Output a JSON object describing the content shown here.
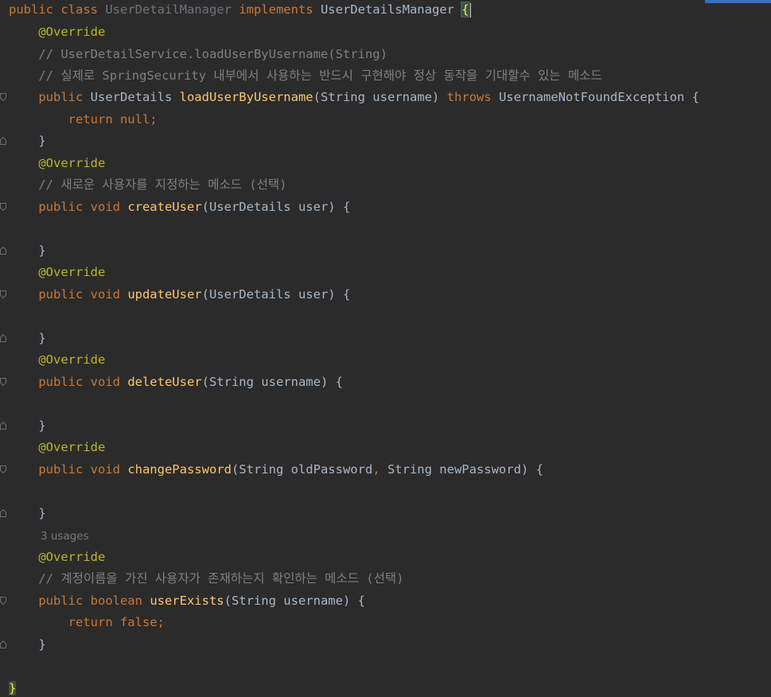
{
  "editor": {
    "lines": [
      {
        "tokens": [
          [
            "kw",
            "public "
          ],
          [
            "kw",
            "class "
          ],
          [
            "cls-unused",
            "UserDetailManager "
          ],
          [
            "kw",
            "implements "
          ],
          [
            "cls",
            "UserDetailsManager "
          ],
          [
            "brace-hl",
            "{"
          ]
        ]
      },
      {
        "tokens": [
          [
            "plain",
            "    "
          ],
          [
            "ann",
            "@Override"
          ]
        ]
      },
      {
        "tokens": [
          [
            "plain",
            "    "
          ],
          [
            "cm",
            "// UserDetailService.loadUserByUsername(String)"
          ]
        ]
      },
      {
        "tokens": [
          [
            "plain",
            "    "
          ],
          [
            "cm",
            "// 실제로 SpringSecurity 내부에서 사용하는 반드시 구현해야 정상 동작을 기대할수 있는 메소드"
          ]
        ]
      },
      {
        "tokens": [
          [
            "plain",
            "    "
          ],
          [
            "kw",
            "public "
          ],
          [
            "cls",
            "UserDetails "
          ],
          [
            "fn",
            "loadUserByUsername"
          ],
          [
            "plain",
            "(String username) "
          ],
          [
            "kw",
            "throws "
          ],
          [
            "cls",
            "UsernameNotFoundException "
          ],
          [
            "plain",
            "{"
          ]
        ]
      },
      {
        "tokens": [
          [
            "plain",
            "        "
          ],
          [
            "kw",
            "return null;"
          ]
        ]
      },
      {
        "tokens": [
          [
            "plain",
            "    }"
          ]
        ]
      },
      {
        "tokens": [
          [
            "plain",
            "    "
          ],
          [
            "ann",
            "@Override"
          ]
        ]
      },
      {
        "tokens": [
          [
            "plain",
            "    "
          ],
          [
            "cm",
            "// 새로운 사용자를 지정하는 메소드 (선택)"
          ]
        ]
      },
      {
        "tokens": [
          [
            "plain",
            "    "
          ],
          [
            "kw",
            "public void "
          ],
          [
            "fn",
            "createUser"
          ],
          [
            "plain",
            "(UserDetails user) {"
          ]
        ]
      },
      {
        "tokens": [
          [
            "plain",
            ""
          ]
        ]
      },
      {
        "tokens": [
          [
            "plain",
            "    }"
          ]
        ]
      },
      {
        "tokens": [
          [
            "plain",
            "    "
          ],
          [
            "ann",
            "@Override"
          ]
        ]
      },
      {
        "tokens": [
          [
            "plain",
            "    "
          ],
          [
            "kw",
            "public void "
          ],
          [
            "fn",
            "updateUser"
          ],
          [
            "plain",
            "(UserDetails user) {"
          ]
        ]
      },
      {
        "tokens": [
          [
            "plain",
            ""
          ]
        ]
      },
      {
        "tokens": [
          [
            "plain",
            "    }"
          ]
        ]
      },
      {
        "tokens": [
          [
            "plain",
            "    "
          ],
          [
            "ann",
            "@Override"
          ]
        ]
      },
      {
        "tokens": [
          [
            "plain",
            "    "
          ],
          [
            "kw",
            "public void "
          ],
          [
            "fn",
            "deleteUser"
          ],
          [
            "plain",
            "(String username) {"
          ]
        ]
      },
      {
        "tokens": [
          [
            "plain",
            ""
          ]
        ]
      },
      {
        "tokens": [
          [
            "plain",
            "    }"
          ]
        ]
      },
      {
        "tokens": [
          [
            "plain",
            "    "
          ],
          [
            "ann",
            "@Override"
          ]
        ]
      },
      {
        "tokens": [
          [
            "plain",
            "    "
          ],
          [
            "kw",
            "public void "
          ],
          [
            "fn",
            "changePassword"
          ],
          [
            "plain",
            "(String oldPassword"
          ],
          [
            "kw",
            ", "
          ],
          [
            "plain",
            "String newPassword) {"
          ]
        ]
      },
      {
        "tokens": [
          [
            "plain",
            ""
          ]
        ]
      },
      {
        "tokens": [
          [
            "plain",
            "    }"
          ]
        ]
      },
      {
        "tokens": [
          [
            "inlay",
            "3 usages"
          ]
        ],
        "inlay": true
      },
      {
        "tokens": [
          [
            "plain",
            "    "
          ],
          [
            "ann",
            "@Override"
          ]
        ]
      },
      {
        "tokens": [
          [
            "plain",
            "    "
          ],
          [
            "cm",
            "// 계정이름을 가진 사용자가 존재하는지 확인하는 메소드 (선택)"
          ]
        ]
      },
      {
        "tokens": [
          [
            "plain",
            "    "
          ],
          [
            "kw",
            "public boolean "
          ],
          [
            "fn",
            "userExists"
          ],
          [
            "plain",
            "(String username) {"
          ]
        ]
      },
      {
        "tokens": [
          [
            "plain",
            "        "
          ],
          [
            "kw",
            "return false;"
          ]
        ]
      },
      {
        "tokens": [
          [
            "plain",
            "    }"
          ]
        ]
      },
      {
        "tokens": [
          [
            "plain",
            ""
          ]
        ]
      },
      {
        "tokens": [
          [
            "brace-end",
            "}"
          ]
        ]
      }
    ],
    "fold_markers": [
      {
        "line": 4,
        "kind": "start"
      },
      {
        "line": 6,
        "kind": "end"
      },
      {
        "line": 9,
        "kind": "start"
      },
      {
        "line": 11,
        "kind": "end"
      },
      {
        "line": 13,
        "kind": "start"
      },
      {
        "line": 15,
        "kind": "end"
      },
      {
        "line": 17,
        "kind": "start"
      },
      {
        "line": 19,
        "kind": "end"
      },
      {
        "line": 21,
        "kind": "start"
      },
      {
        "line": 23,
        "kind": "end"
      },
      {
        "line": 27,
        "kind": "start"
      },
      {
        "line": 29,
        "kind": "end"
      }
    ]
  },
  "colors": {
    "background": "#2b2b2b",
    "keyword": "#cc7832",
    "function": "#ffc66d",
    "annotation": "#bbb529",
    "comment": "#808080",
    "text": "#a9b7c6",
    "unused_class": "#72737a",
    "inlay_hint": "#787878",
    "matched_brace": "#ffef28"
  }
}
